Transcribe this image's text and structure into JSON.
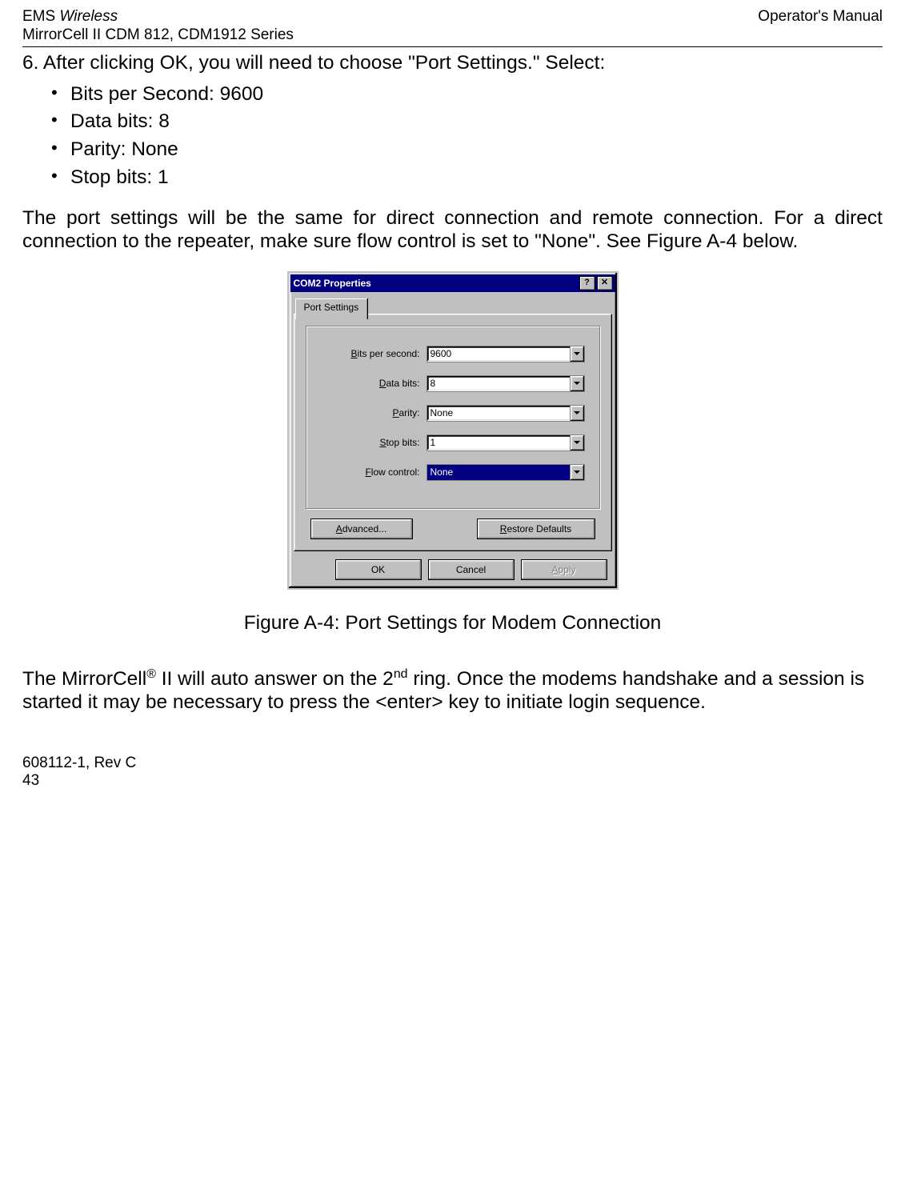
{
  "header": {
    "left_line1_italic": "EMS ",
    "left_line1_plain": "Wireless",
    "left_line2": "MirrorCell II CDM 812, CDM1912 Series",
    "right_line1": "Operator's Manual"
  },
  "step6": "6.  After clicking OK, you will need to choose \"Port Settings.\" Select:",
  "bullets": [
    "Bits per Second: 9600",
    "Data bits: 8",
    "Parity: None",
    "Stop bits: 1"
  ],
  "para1": "The port settings will be the same for direct connection and remote connection. For a direct connection to the repeater, make sure flow control is set to \"None\".   See Figure A-4 below.",
  "dialog": {
    "title": "COM2 Properties",
    "help_btn": "?",
    "close_btn": "✕",
    "tab": "Port Settings",
    "rows": {
      "bits_per_second": {
        "label_pre": "B",
        "label_rest": "its per second:",
        "value": "9600"
      },
      "data_bits": {
        "label_pre": "D",
        "label_rest": "ata bits:",
        "value": "8"
      },
      "parity": {
        "label_pre": "P",
        "label_rest": "arity:",
        "value": "None"
      },
      "stop_bits": {
        "label_pre": "S",
        "label_rest": "top bits:",
        "value": "1"
      },
      "flow_control": {
        "label_pre": "F",
        "label_rest": "low control:",
        "value": "None"
      }
    },
    "advanced_pre": "A",
    "advanced_rest": "dvanced...",
    "restore_pre": "R",
    "restore_rest": "estore Defaults",
    "ok": "OK",
    "cancel": "Cancel",
    "apply_pre": "A",
    "apply_rest": "pply"
  },
  "caption": "Figure A-4:  Port Settings for Modem Connection",
  "para2_pre": "The MirrorCell",
  "para2_reg": "®",
  "para2_mid": " II  will auto answer on the 2",
  "para2_sup": "nd",
  "para2_post": " ring. Once the modems handshake and a session is started it may be necessary to press the <enter> key to initiate login sequence.",
  "footer": {
    "line1": "608112-1, Rev C",
    "line2": "43"
  }
}
